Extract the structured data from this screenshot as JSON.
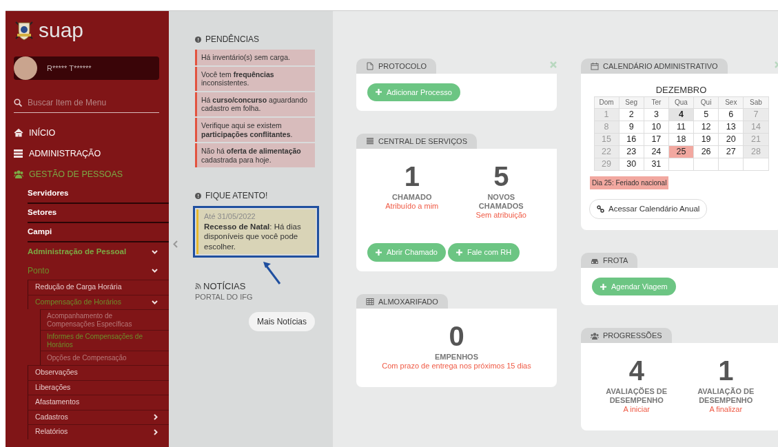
{
  "sidebar": {
    "logo_text": "suap",
    "user_name": "R***** T******",
    "search": {
      "placeholder": "Buscar Item de Menu"
    },
    "menu": [
      {
        "label": "INÍCIO",
        "active": false
      },
      {
        "label": "ADMINISTRAÇÃO",
        "active": false
      },
      {
        "label": "GESTÃO DE PESSOAS",
        "active": true,
        "children": [
          {
            "label": "Servidores",
            "active": false
          },
          {
            "label": "Setores",
            "active": false
          },
          {
            "label": "Campi",
            "active": false
          },
          {
            "label": "Administração de Pessoal",
            "active": true,
            "expanded": true,
            "children": [
              {
                "label": "Ponto",
                "active": true,
                "expanded": true,
                "children": [
                  {
                    "label": "Redução de Carga Horária",
                    "active": false
                  },
                  {
                    "label": "Compensação de Horários",
                    "active": true,
                    "expanded": true,
                    "children": [
                      {
                        "label": "Acompanhamento de Compensações Específicas",
                        "active": false
                      },
                      {
                        "label": "Informes de Compensações de Horários",
                        "active": true
                      },
                      {
                        "label": "Opções de Compensação",
                        "active": false
                      }
                    ]
                  },
                  {
                    "label": "Observações",
                    "active": false
                  },
                  {
                    "label": "Liberações",
                    "active": false
                  },
                  {
                    "label": "Afastamentos",
                    "active": false
                  },
                  {
                    "label": "Cadastros",
                    "active": false,
                    "expanded": false
                  },
                  {
                    "label": "Relatórios",
                    "active": false,
                    "expanded": false
                  }
                ]
              }
            ]
          }
        ]
      }
    ]
  },
  "side_panel": {
    "pendencias": {
      "title": "PENDÊNCIAS",
      "items": [
        "Há inventário(s) sem carga.",
        "Você tem **frequências** inconsistentes.",
        "Há **curso/concurso** aguardando cadastro em folha.",
        "Verifique aqui se existem **participações conflitantes**.",
        "Não há **oferta de alimentação** cadastrada para hoje."
      ]
    },
    "fique_atento": {
      "title": "FIQUE ATENTO!",
      "highlighted": true,
      "items": [
        {
          "date": "Até 31/05/2022",
          "text": "**Recesso de Natal**: Há dias disponíveis que você pode escolher."
        }
      ]
    },
    "noticias": {
      "title": "NOTÍCIAS",
      "source": "PORTAL DO IFG",
      "button": "Mais Notícias"
    }
  },
  "widgets": {
    "left": [
      {
        "title": "PROTOCOLO",
        "closable": true,
        "buttons": [
          "Adicionar Processo"
        ]
      },
      {
        "title": "CENTRAL DE SERVIÇOS",
        "closable": false,
        "stats": [
          {
            "value": "1",
            "label": "CHAMADO",
            "sub": "Atribuído a mim"
          },
          {
            "value": "5",
            "label": "NOVOS CHAMADOS",
            "sub": "Sem atribuição"
          }
        ],
        "buttons": [
          "Abrir Chamado",
          "Fale com RH"
        ]
      },
      {
        "title": "ALMOXARIFADO",
        "closable": false,
        "stats": [
          {
            "value": "0",
            "label": "EMPENHOS",
            "sub": "Com prazo de entrega nos próximos 15 dias"
          }
        ]
      }
    ],
    "right": [
      {
        "title": "CALENDÁRIO ADMINISTRATIVO",
        "closable": true,
        "calendar": {
          "month": "DEZEMBRO",
          "weekdays": [
            "Dom",
            "Seg",
            "Ter",
            "Qua",
            "Qui",
            "Sex",
            "Sab"
          ],
          "days": [
            {
              "d": "1",
              "kind": "weekend"
            },
            {
              "d": "2",
              "kind": "weekday"
            },
            {
              "d": "3",
              "kind": "weekday"
            },
            {
              "d": "4",
              "kind": "today"
            },
            {
              "d": "5",
              "kind": "weekday"
            },
            {
              "d": "6",
              "kind": "weekday"
            },
            {
              "d": "7",
              "kind": "weekend"
            },
            {
              "d": "8",
              "kind": "weekend"
            },
            {
              "d": "9",
              "kind": "weekday"
            },
            {
              "d": "10",
              "kind": "weekday"
            },
            {
              "d": "11",
              "kind": "weekday"
            },
            {
              "d": "12",
              "kind": "weekday"
            },
            {
              "d": "13",
              "kind": "weekday"
            },
            {
              "d": "14",
              "kind": "weekend"
            },
            {
              "d": "15",
              "kind": "weekend"
            },
            {
              "d": "16",
              "kind": "weekday"
            },
            {
              "d": "17",
              "kind": "weekday"
            },
            {
              "d": "18",
              "kind": "weekday"
            },
            {
              "d": "19",
              "kind": "weekday"
            },
            {
              "d": "20",
              "kind": "weekday"
            },
            {
              "d": "21",
              "kind": "weekend"
            },
            {
              "d": "22",
              "kind": "weekend"
            },
            {
              "d": "23",
              "kind": "weekday"
            },
            {
              "d": "24",
              "kind": "weekday"
            },
            {
              "d": "25",
              "kind": "holiday"
            },
            {
              "d": "26",
              "kind": "weekday"
            },
            {
              "d": "27",
              "kind": "weekday"
            },
            {
              "d": "28",
              "kind": "weekend"
            },
            {
              "d": "29",
              "kind": "weekend"
            },
            {
              "d": "30",
              "kind": "weekday"
            },
            {
              "d": "31",
              "kind": "weekday"
            }
          ],
          "legend": [
            "Dia 25: Feriado nacional"
          ],
          "link_button": "Acessar Calendário Anual"
        }
      },
      {
        "title": "FROTA",
        "closable": false,
        "buttons": [
          "Agendar Viagem"
        ]
      },
      {
        "title": "PROGRESSÕES",
        "closable": false,
        "stats": [
          {
            "value": "4",
            "label": "AVALIAÇÕES DE DESEMPENHO",
            "sub": "A iniciar"
          },
          {
            "value": "1",
            "label": "AVALIAÇÃO DE DESEMPENHO",
            "sub": "A finalizar"
          }
        ]
      }
    ]
  }
}
